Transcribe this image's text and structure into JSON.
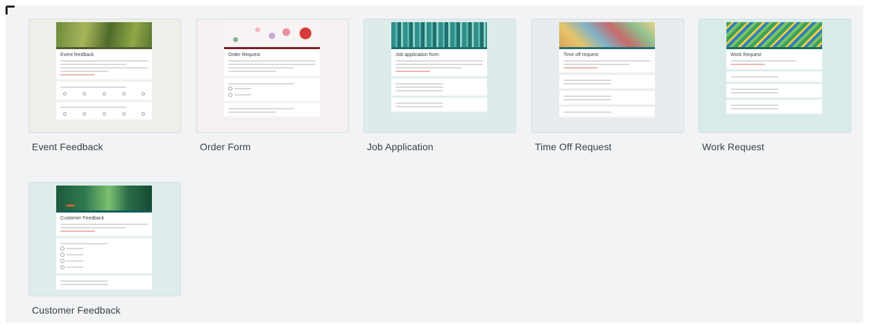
{
  "templates": [
    {
      "label": "Event Feedback",
      "form_title": "Event feedback",
      "thumb_bg": "#efefe9",
      "accent": "#4e5b31",
      "banner": "#5f7a2f",
      "banner_alt": "#a8b55a"
    },
    {
      "label": "Order Form",
      "form_title": "Order Request",
      "thumb_bg": "#f6f1f1",
      "accent": "#7a1f2a",
      "banner": "#f7f4f3",
      "banner_alt": "#d63a3a"
    },
    {
      "label": "Job Application",
      "form_title": "Job application form",
      "thumb_bg": "#ddeceb",
      "accent": "#1f6b6b",
      "banner": "#2f8f8a",
      "banner_alt": "#8fd1c8"
    },
    {
      "label": "Time Off Request",
      "form_title": "Time off request",
      "thumb_bg": "#e8ecef",
      "accent": "#2c6a73",
      "banner": "#d9a55c",
      "banner_alt": "#7fb3c7"
    },
    {
      "label": "Work Request",
      "form_title": "Work Request",
      "thumb_bg": "#d8ebe9",
      "accent": "#1a6b5a",
      "banner": "#3da35a",
      "banner_alt": "#f2c94c"
    },
    {
      "label": "Customer Feedback",
      "form_title": "Customer Feedback",
      "thumb_bg": "#deedeb",
      "accent": "#0f5d5d",
      "banner": "#1e5a3c",
      "banner_alt": "#7cc070"
    }
  ]
}
